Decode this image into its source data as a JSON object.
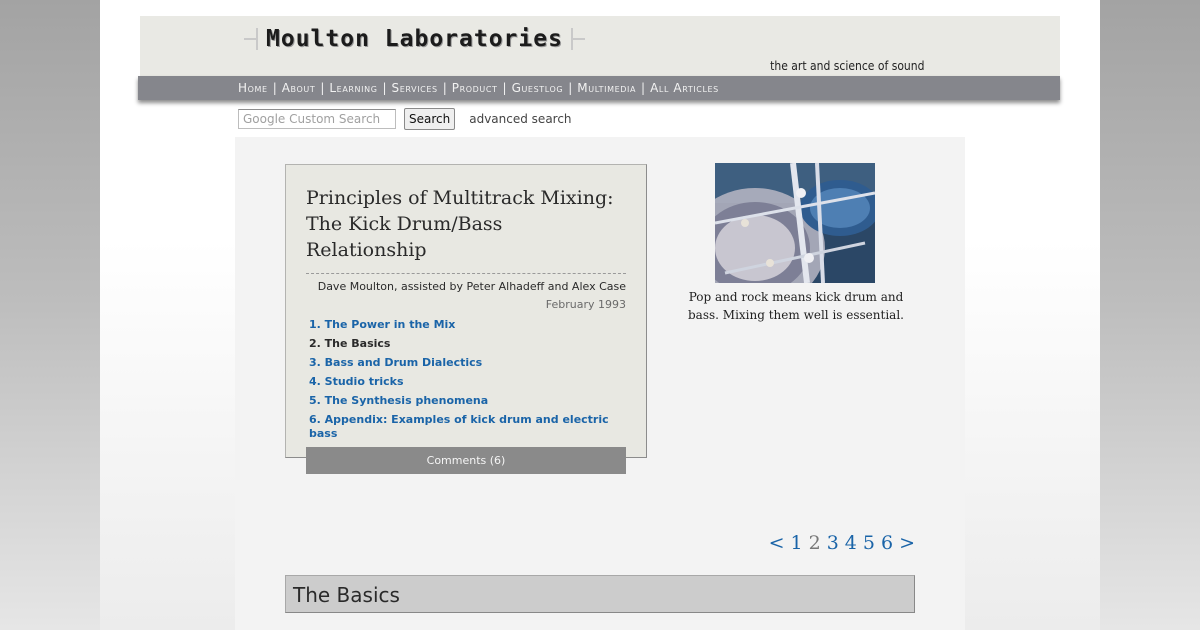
{
  "site": {
    "logo_text": "Moulton Laboratories",
    "tagline": "the art and science of sound"
  },
  "nav": {
    "items": [
      {
        "label": "Home"
      },
      {
        "label": "About"
      },
      {
        "label": "Learning"
      },
      {
        "label": "Services"
      },
      {
        "label": "Product"
      },
      {
        "label": "Guestlog"
      },
      {
        "label": "Multimedia"
      },
      {
        "label": "All Articles"
      }
    ],
    "separator": "|"
  },
  "search": {
    "placeholder": "Google Custom Search",
    "button_label": "Search",
    "advanced_label": "advanced search"
  },
  "article": {
    "title_line1": "Principles of Multitrack Mixing:",
    "title_line2": "The Kick Drum/Bass Relationship",
    "byline": "Dave Moulton, assisted by Peter Alhadeff and Alex Case",
    "date": "February 1993",
    "toc": [
      {
        "label": "1. The Power in the Mix"
      },
      {
        "label": "2. The Basics"
      },
      {
        "label": "3. Bass and Drum Dialectics"
      },
      {
        "label": "4. Studio tricks"
      },
      {
        "label": "5. The Synthesis phenomena"
      },
      {
        "label": "6. Appendix: Examples of kick drum and electric bass"
      }
    ],
    "comments_label": "Comments",
    "comments_count": "(6)"
  },
  "photo": {
    "caption": "Pop and rock means kick drum and bass. Mixing them well is essential."
  },
  "pager": {
    "prev": "<",
    "pages": [
      "1",
      "2",
      "3",
      "4",
      "5",
      "6"
    ],
    "current": "2",
    "next": ">"
  },
  "section": {
    "heading": "The Basics"
  },
  "colors": {
    "link": "#1a64a8",
    "navbar": "#85868c",
    "masthead": "#e9e9e4"
  }
}
